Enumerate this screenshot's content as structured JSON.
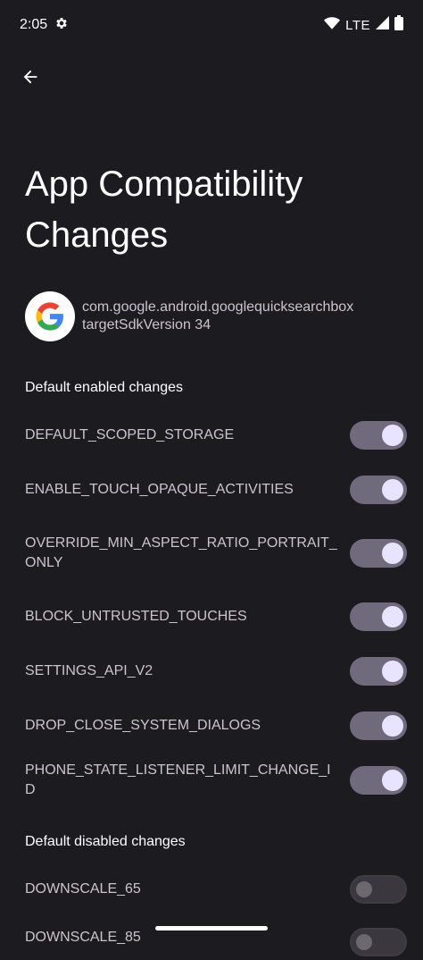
{
  "status": {
    "time": "2:05",
    "network": "LTE"
  },
  "title": "App Compatibility Changes",
  "app": {
    "package": "com.google.android.googlequicksearchbox",
    "target_sdk": "targetSdkVersion 34"
  },
  "sections": {
    "enabled_header": "Default enabled changes",
    "disabled_header": "Default disabled changes"
  },
  "enabled_changes": [
    {
      "label": "DEFAULT_SCOPED_STORAGE",
      "on": true
    },
    {
      "label": "ENABLE_TOUCH_OPAQUE_ACTIVITIES",
      "on": true
    },
    {
      "label": "OVERRIDE_MIN_ASPECT_RATIO_PORTRAIT_ONLY",
      "on": true
    },
    {
      "label": "BLOCK_UNTRUSTED_TOUCHES",
      "on": true
    },
    {
      "label": "SETTINGS_API_V2",
      "on": true
    },
    {
      "label": "DROP_CLOSE_SYSTEM_DIALOGS",
      "on": true
    },
    {
      "label": "PHONE_STATE_LISTENER_LIMIT_CHANGE_ID",
      "on": true
    }
  ],
  "disabled_changes": [
    {
      "label": "DOWNSCALE_65",
      "on": false
    },
    {
      "label": "DOWNSCALE_85",
      "on": false
    }
  ],
  "colors": {
    "background": "#1c1b20",
    "switch_on_track": "#6f6b7c",
    "switch_on_thumb": "#e8e4ff"
  }
}
